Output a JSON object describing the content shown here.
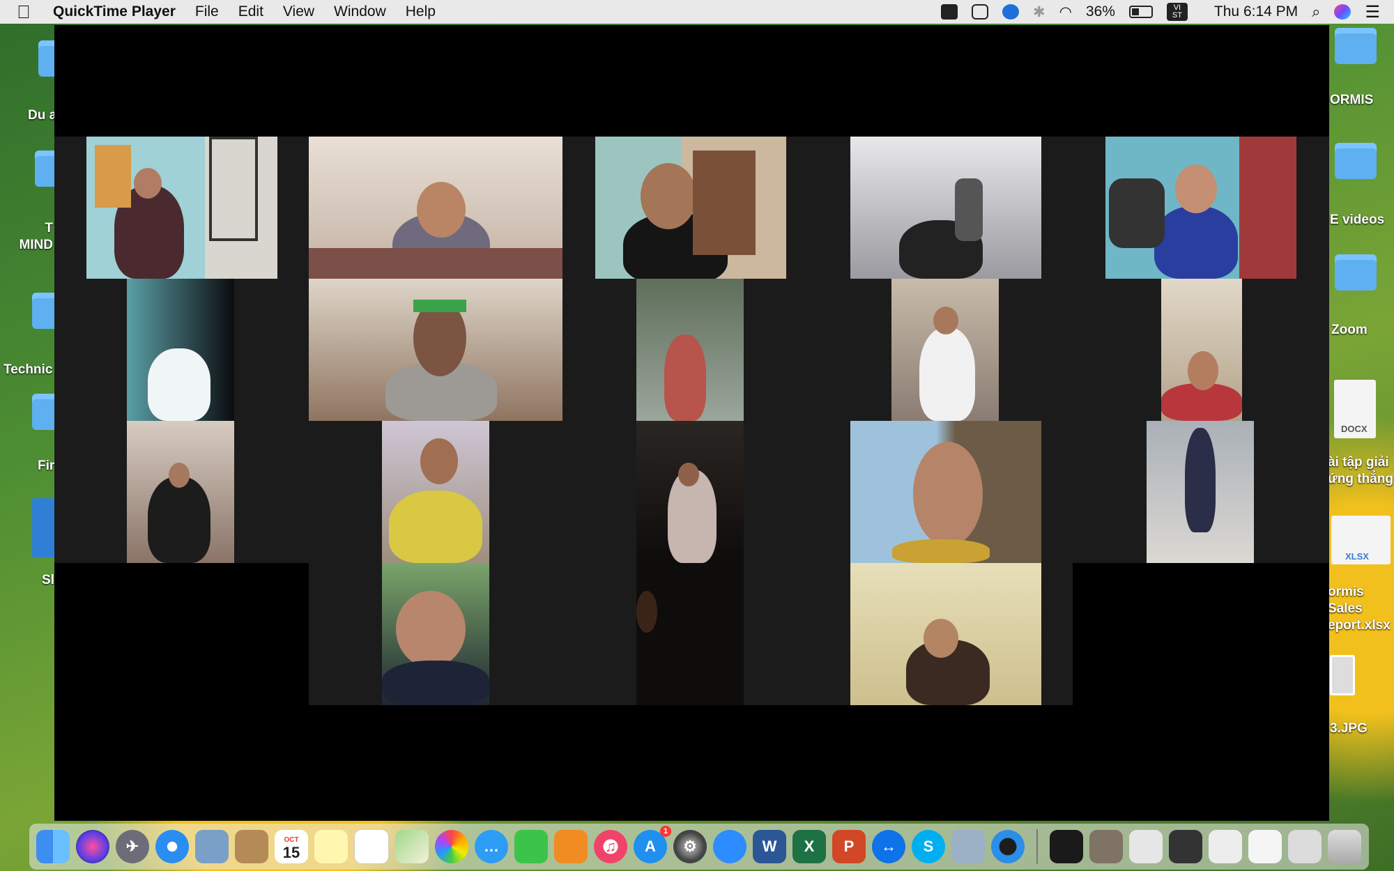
{
  "menubar": {
    "apple_icon": "apple-icon",
    "app_name": "QuickTime Player",
    "menus": [
      "File",
      "Edit",
      "View",
      "Window",
      "Help"
    ],
    "status": {
      "battery": "36%",
      "input_source": "VI ST",
      "clock": "Thu 6:14 PM"
    }
  },
  "desktop_left": {
    "items": [
      "Du a",
      "T MIND",
      "Technic",
      "Fir",
      "Sl"
    ]
  },
  "desktop_right": {
    "items": [
      "ORMIS",
      "E videos",
      "Zoom",
      "DOCX",
      "ài tập giải ứng thẳng",
      "XLSX",
      "ormis Sales eport.xlsx",
      "3.JPG"
    ]
  },
  "video_grid": {
    "participant_tiles": 19,
    "colors": {
      "window_bg": "#000000",
      "band_bg": "#1b1b1b"
    }
  },
  "dock": {
    "calendar_month": "OCT",
    "calendar_day": "15",
    "app_store_badge": "1",
    "icons": [
      "finder-icon",
      "siri-icon",
      "launchpad-icon",
      "safari-icon",
      "preview-icon",
      "contacts-icon",
      "calendar-icon",
      "notes-icon",
      "reminders-icon",
      "maps-icon",
      "photos-icon",
      "messages-icon",
      "facetime-icon",
      "books-icon",
      "music-icon",
      "app-store-icon",
      "system-preferences-icon",
      "zoom-icon",
      "word-icon",
      "excel-icon",
      "powerpoint-icon",
      "teamviewer-icon",
      "skype-icon",
      "image-capture-icon",
      "quicktime-icon",
      "window-thumb-icon",
      "document-thumb-icon",
      "window-thumb-icon",
      "window-thumb-icon",
      "window-thumb-icon",
      "window-thumb-icon",
      "window-thumb-icon",
      "trash-icon"
    ]
  }
}
